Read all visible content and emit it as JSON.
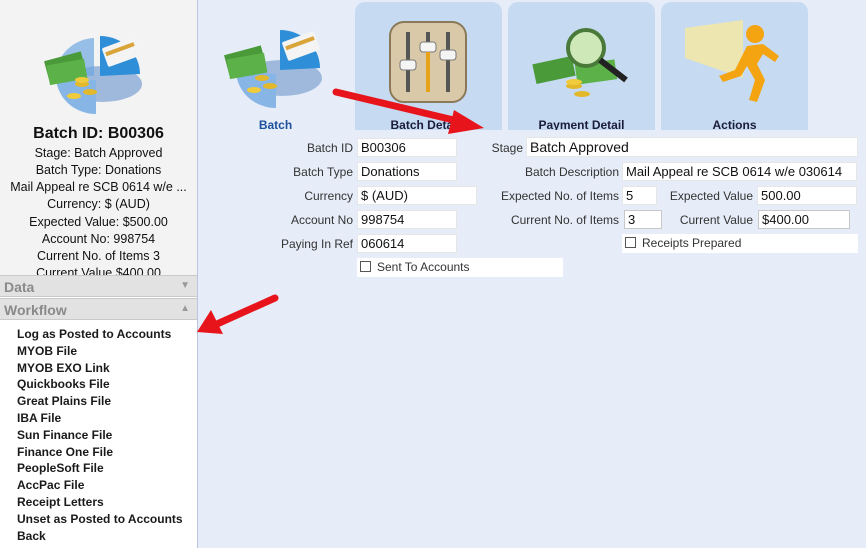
{
  "summary": {
    "batch_heading": "Batch ID: B00306",
    "lines": [
      "Stage: Batch Approved",
      "Batch Type: Donations",
      "Mail Appeal re SCB 0614 w/e ...",
      "Currency: $ (AUD)",
      "Expected Value: $500.00",
      "Account No: 998754",
      "Current No. of Items 3",
      "Current Value $400.00"
    ]
  },
  "accordion": {
    "data_label": "Data",
    "workflow_label": "Workflow"
  },
  "workflow_items": [
    "Log as Posted to Accounts",
    "MYOB File",
    "MYOB EXO Link",
    "Quickbooks File",
    "Great Plains File",
    "IBA File",
    "Sun Finance File",
    "Finance One File",
    "PeopleSoft File",
    "AccPac File",
    "Receipt Letters",
    "Unset as Posted to Accounts",
    "Back"
  ],
  "tabs": {
    "batch": "Batch",
    "batch_details": "Batch Details",
    "payment_detail": "Payment Detail",
    "actions": "Actions"
  },
  "form": {
    "batch_id_label": "Batch ID",
    "batch_id": "B00306",
    "batch_type_label": "Batch Type",
    "batch_type": "Donations",
    "currency_label": "Currency",
    "currency": "$ (AUD)",
    "account_no_label": "Account No",
    "account_no": "998754",
    "paying_in_ref_label": "Paying In Ref",
    "paying_in_ref": "060614",
    "sent_to_accounts_label": "Sent To Accounts",
    "stage_label": "Stage",
    "stage": "Batch Approved",
    "batch_description_label": "Batch Description",
    "batch_description": "Mail Appeal re SCB 0614 w/e 030614",
    "expected_items_label": "Expected No. of Items",
    "expected_items": "5",
    "expected_value_label": "Expected Value",
    "expected_value": "500.00",
    "current_items_label": "Current No. of Items",
    "current_items": "3",
    "current_value_label": "Current Value",
    "current_value": "$400.00",
    "receipts_prepared_label": "Receipts Prepared"
  },
  "colors": {
    "annotation_arrow": "#e8141b",
    "active_tab_text": "#1c4f9c",
    "tab_background": "#c6dbf2",
    "content_background": "#e6ecf8"
  }
}
